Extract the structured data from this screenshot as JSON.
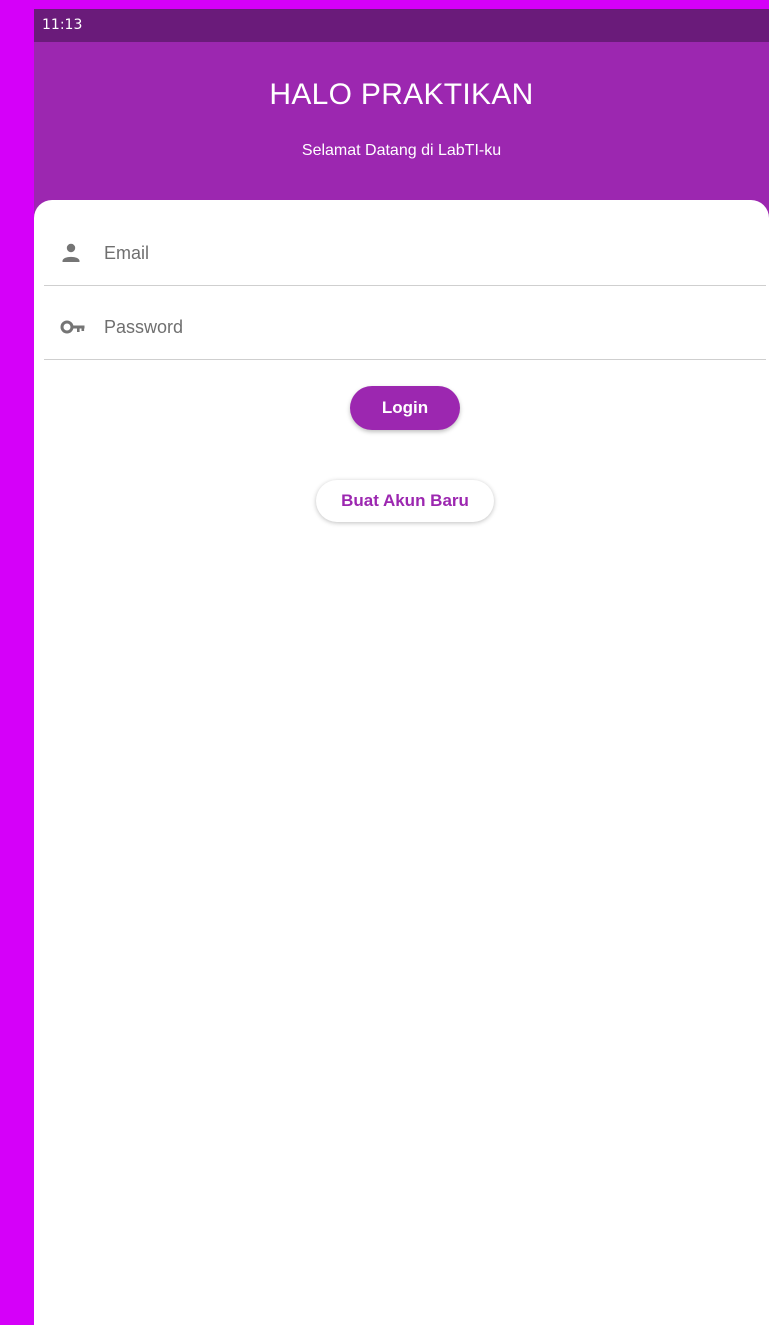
{
  "status_bar": {
    "time": "11:13"
  },
  "header": {
    "title": "HALO PRAKTIKAN",
    "subtitle": "Selamat Datang di LabTI-ku"
  },
  "form": {
    "email": {
      "icon": "person-icon",
      "placeholder": "Email",
      "value": ""
    },
    "password": {
      "icon": "key-icon",
      "placeholder": "Password",
      "value": ""
    }
  },
  "actions": {
    "login_label": "Login",
    "register_label": "Buat Akun Baru"
  },
  "colors": {
    "background": "#d500f9",
    "primary": "#9c27b0",
    "status_bar": "#6a1b7a",
    "card": "#ffffff",
    "icon": "#757575"
  }
}
